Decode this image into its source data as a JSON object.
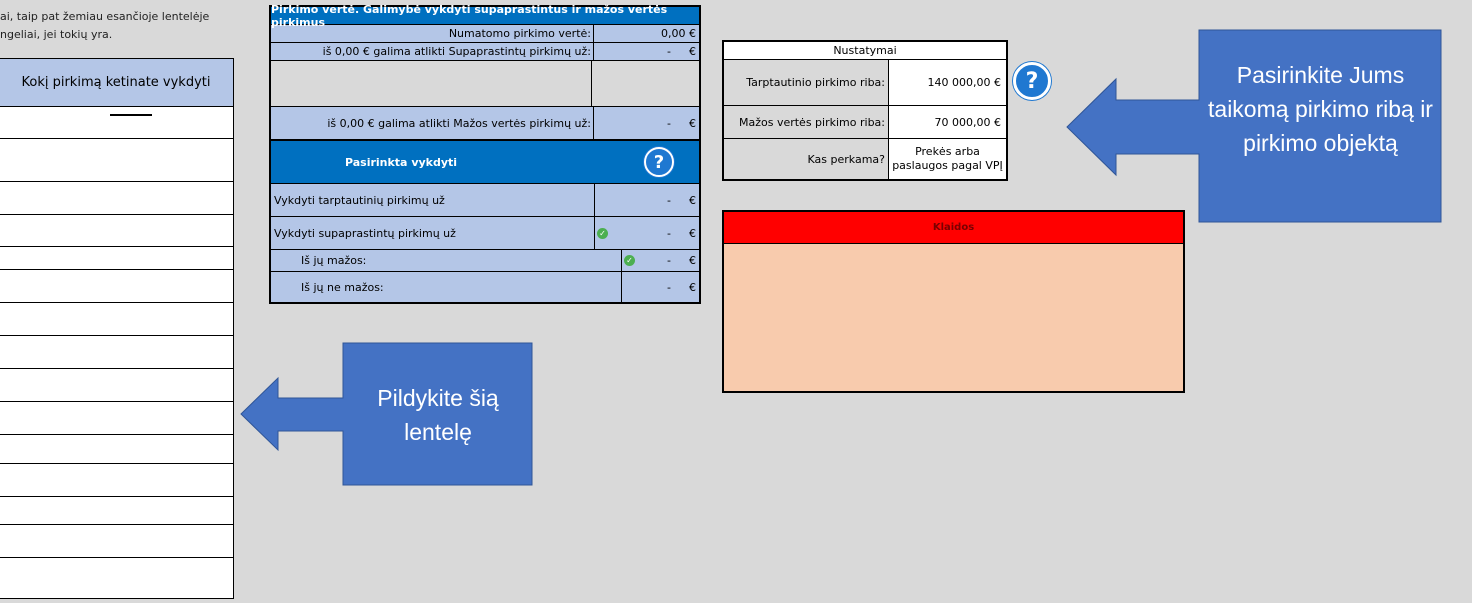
{
  "intro": {
    "line1": "ai, taip pat žemiau esančioje lentelėje",
    "line2": "ngeliai, jei tokių yra."
  },
  "left_table": {
    "header": "Kokį pirkimą ketinate vykdyti",
    "row_count": 15
  },
  "purchase": {
    "title": "Pirkimo vertė. Galimybė vykdyti supaprastintus ir mažos vertės pirkimus",
    "rows": [
      {
        "label": "Numatomo pirkimo vertė:",
        "value": "0,00 €"
      },
      {
        "label": "iš 0,00 € galima atlikti Supaprastintų pirkimų už:",
        "value": "-",
        "cur": "€"
      },
      {
        "label": "iš 0,00 € galima atlikti Mažos vertės pirkimų už:",
        "value": "-",
        "cur": "€"
      }
    ],
    "selected_title": "Pasirinkta vykdyti",
    "selected_rows": [
      {
        "label": "Vykdyti tarptautinių pirkimų už",
        "value": "-",
        "cur": "€"
      },
      {
        "label": "Vykdyti supaprastintų pirkimų už",
        "value": "-",
        "cur": "€"
      },
      {
        "label": "Iš jų mažos:",
        "value": "-",
        "cur": "€"
      },
      {
        "label": "Iš jų ne mažos:",
        "value": "-",
        "cur": "€"
      }
    ]
  },
  "settings": {
    "title": "Nustatymai",
    "rows": [
      {
        "label": "Tarptautinio pirkimo riba:",
        "value": "140 000,00 €"
      },
      {
        "label": "Mažos vertės pirkimo riba:",
        "value": "70 000,00 €"
      },
      {
        "label": "Kas perkama?",
        "value": "Prekės arba paslaugos pagal VPĮ"
      }
    ]
  },
  "errors": {
    "title": "Klaidos"
  },
  "callouts": {
    "right": "Pasirinkite Jums taikomą pirkimo ribą ir pirkimo objektą",
    "left": "Pildykite šią lentelę"
  },
  "colors": {
    "header_blue": "#0070c0",
    "light_blue": "#b4c6e7",
    "callout": "#4472c4",
    "error_red": "#ff0000",
    "error_bg": "#f8cbad"
  }
}
